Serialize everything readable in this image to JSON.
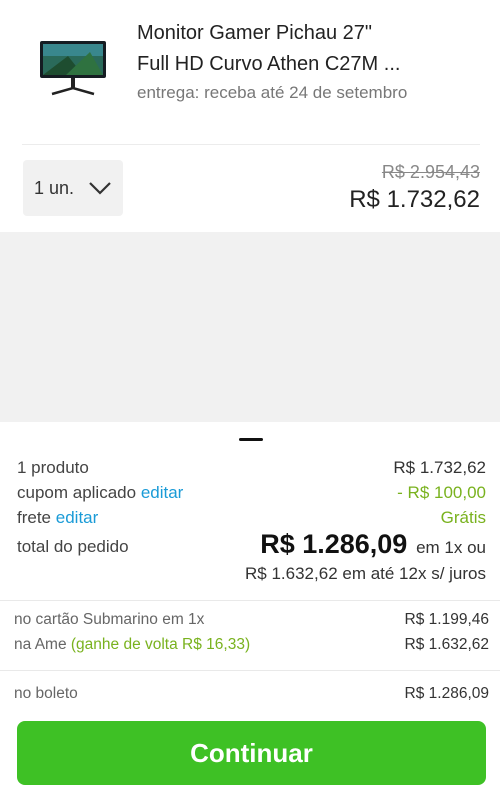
{
  "product": {
    "name_line1": "Monitor Gamer Pichau 27\"",
    "name_line2": "Full HD Curvo Athen C27M ...",
    "delivery": "entrega: receba até 24 de setembro",
    "quantity": "1 un.",
    "old_price": "R$ 2.954,43",
    "price": "R$ 1.732,62",
    "image_icon": "monitor-icon"
  },
  "summary": {
    "products_label": "1 produto",
    "products_value": "R$ 1.732,62",
    "coupon_label": "cupom aplicado",
    "coupon_edit": "editar",
    "coupon_value": "- R$ 100,00",
    "shipping_label": "frete",
    "shipping_edit": "editar",
    "shipping_value": "Grátis",
    "total_label": "total do pedido",
    "total_value": "R$ 1.286,09",
    "total_suffix": "em 1x ou",
    "installments": "R$ 1.632,62 em até 12x s/ juros"
  },
  "payments": [
    {
      "label": "no cartão Submarino em 1x",
      "value": "R$ 1.199,46"
    },
    {
      "label": "na Ame",
      "cashback": "(ganhe de volta R$ 16,33)",
      "value": "R$ 1.632,62"
    },
    {
      "label": "no boleto",
      "value": "R$ 1.286,09"
    }
  ],
  "continue_button": "Continuar",
  "colors": {
    "accent_green": "#3ec125",
    "link_blue": "#1a9bd7",
    "discount_green": "#79b21e"
  }
}
